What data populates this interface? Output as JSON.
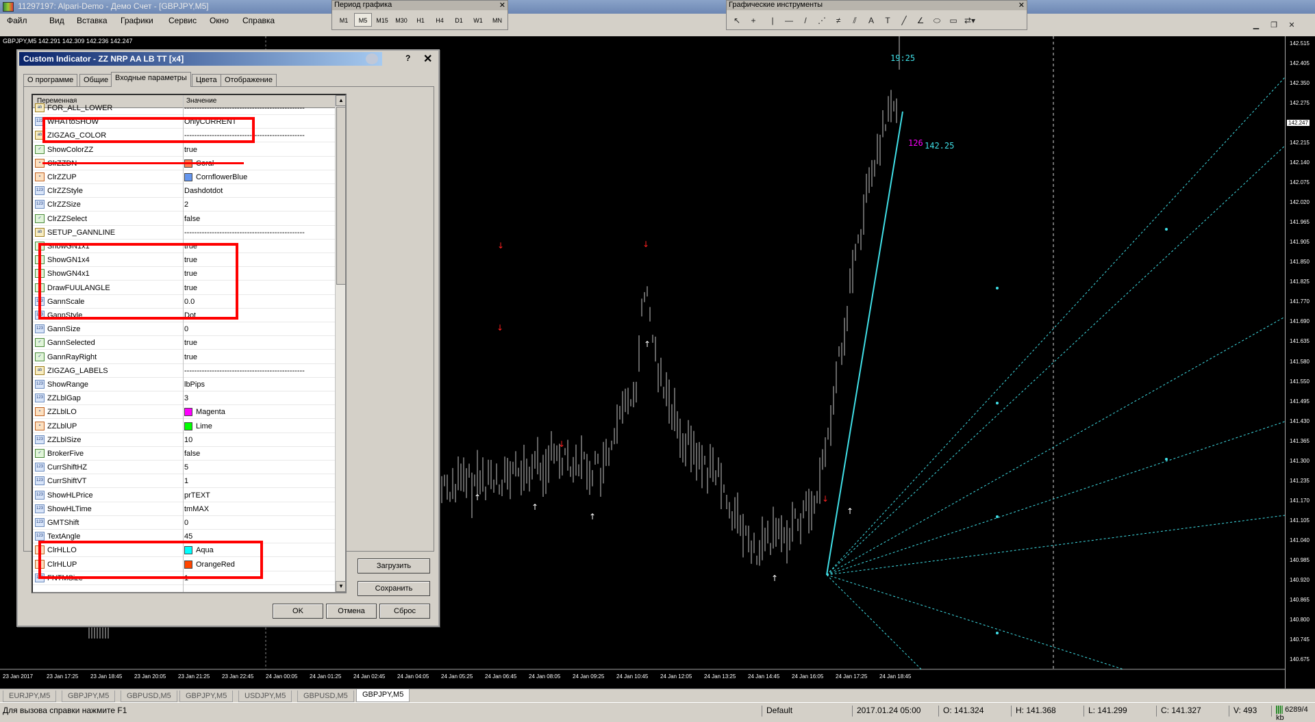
{
  "window": {
    "title": "11297197: Alpari-Demo - Демо Счет - [GBPJPY,M5]"
  },
  "menu": [
    "Файл",
    "Вид",
    "Вставка",
    "Графики",
    "Сервис",
    "Окно",
    "Справка"
  ],
  "period_toolbar": {
    "title": "Период графика",
    "periods": [
      "M1",
      "M5",
      "M15",
      "M30",
      "H1",
      "H4",
      "D1",
      "W1",
      "MN"
    ],
    "selected": "M5"
  },
  "tools_toolbar": {
    "title": "Графические инструменты",
    "tools": [
      "cursor-icon",
      "crosshair-icon",
      "vertical-line-icon",
      "horizontal-line-icon",
      "trendline-icon",
      "fibo-fan-icon",
      "gann-line-icon",
      "fibo-retracement-icon",
      "text-icon",
      "text-label-icon",
      "channel-icon",
      "angle-icon",
      "ellipse-icon",
      "rectangle-icon",
      "arrows-icon"
    ],
    "tool_glyphs": [
      "↖",
      "+",
      "|",
      "—",
      "/",
      "⋰",
      "≠",
      "⫽",
      "A",
      "T",
      "╱",
      "∠",
      "⬭",
      "▭",
      "⇄▾"
    ]
  },
  "chart": {
    "info": "GBPJPY,M5  142.291 142.309 142.236 142.247",
    "price_labels": [
      "142.515",
      "142.405",
      "142.350",
      "142.275",
      "142.247",
      "142.215",
      "142.140",
      "142.075",
      "142.020",
      "141.965",
      "141.905",
      "141.850",
      "141.825",
      "141.770",
      "141.690",
      "141.635",
      "141.580",
      "141.550",
      "141.495",
      "141.430",
      "141.365",
      "141.300",
      "141.235",
      "141.170",
      "141.105",
      "141.040",
      "140.985",
      "140.920",
      "140.865",
      "140.800",
      "140.745",
      "140.675"
    ],
    "current_price": "142.247",
    "time_labels": [
      "23 Jan 2017",
      "23 Jan 17:25",
      "23 Jan 18:45",
      "23 Jan 20:05",
      "23 Jan 21:25",
      "23 Jan 22:45",
      "24 Jan 00:05",
      "24 Jan 01:25",
      "24 Jan 02:45",
      "24 Jan 04:05",
      "24 Jan 05:25",
      "24 Jan 06:45",
      "24 Jan 08:05",
      "24 Jan 09:25",
      "24 Jan 10:45",
      "24 Jan 12:05",
      "24 Jan 13:25",
      "24 Jan 14:45",
      "24 Jan 16:05",
      "24 Jan 17:25",
      "24 Jan 18:45"
    ],
    "annotation_time": "19:25",
    "annotation_pips": "126",
    "annotation_price": "142.25",
    "colors": {
      "zz_line": "#40e0e8",
      "gann": "#40e0e8",
      "label_time": "#40e0e8",
      "label_pips": "#ff00ff",
      "arrow_dn": "#ff2020",
      "arrow_up": "#ffffff"
    }
  },
  "dialog": {
    "title": "Custom Indicator - ZZ NRP AA LB TT [x4]",
    "help": "?",
    "close": "✕",
    "tabs": [
      "О программе",
      "Общие",
      "Входные параметры",
      "Цвета",
      "Отображение"
    ],
    "selected_tab": "Входные параметры",
    "columns": {
      "var": "Переменная",
      "val": "Значение"
    },
    "rows": [
      {
        "name": "FOR_ALL_LOWER",
        "value": "------------------------------------------------",
        "type": "str"
      },
      {
        "name": "WHATtoSHOW",
        "value": "OnlyCURRENT",
        "type": "int"
      },
      {
        "name": "ZIGZAG_COLOR",
        "value": "------------------------------------------------",
        "type": "str"
      },
      {
        "name": "ShowColorZZ",
        "value": "true",
        "type": "bool"
      },
      {
        "name": "ClrZZDN",
        "value": "Coral",
        "type": "col",
        "color": "#ff7f50"
      },
      {
        "name": "ClrZZUP",
        "value": "CornflowerBlue",
        "type": "col",
        "color": "#6495ed"
      },
      {
        "name": "ClrZZStyle",
        "value": "Dashdotdot",
        "type": "int"
      },
      {
        "name": "ClrZZSize",
        "value": "2",
        "type": "int"
      },
      {
        "name": "ClrZZSelect",
        "value": "false",
        "type": "bool"
      },
      {
        "name": "SETUP_GANNLINE",
        "value": "------------------------------------------------",
        "type": "str"
      },
      {
        "name": "ShowGN1x1",
        "value": "true",
        "type": "bool"
      },
      {
        "name": "ShowGN1x4",
        "value": "true",
        "type": "bool"
      },
      {
        "name": "ShowGN4x1",
        "value": "true",
        "type": "bool"
      },
      {
        "name": "DrawFUULANGLE",
        "value": "true",
        "type": "bool"
      },
      {
        "name": "GannScale",
        "value": "0.0",
        "type": "int"
      },
      {
        "name": "GannStyle",
        "value": "Dot",
        "type": "int"
      },
      {
        "name": "GannSize",
        "value": "0",
        "type": "int"
      },
      {
        "name": "GannSelected",
        "value": "true",
        "type": "bool"
      },
      {
        "name": "GannRayRight",
        "value": "true",
        "type": "bool"
      },
      {
        "name": "ZIGZAG_LABELS",
        "value": "------------------------------------------------",
        "type": "str"
      },
      {
        "name": "ShowRange",
        "value": "lbPips",
        "type": "int"
      },
      {
        "name": "ZZLblGap",
        "value": "3",
        "type": "int"
      },
      {
        "name": "ZZLblLO",
        "value": "Magenta",
        "type": "col",
        "color": "#ff00ff"
      },
      {
        "name": "ZZLblUP",
        "value": "Lime",
        "type": "col",
        "color": "#00ff00"
      },
      {
        "name": "ZZLblSize",
        "value": "10",
        "type": "int"
      },
      {
        "name": "BrokerFive",
        "value": "false",
        "type": "bool"
      },
      {
        "name": "CurrShiftHZ",
        "value": "5",
        "type": "int"
      },
      {
        "name": "CurrShiftVT",
        "value": "1",
        "type": "int"
      },
      {
        "name": "ShowHLPrice",
        "value": "prTEXT",
        "type": "int"
      },
      {
        "name": "ShowHLTime",
        "value": "tmMAX",
        "type": "int"
      },
      {
        "name": "GMTShift",
        "value": "0",
        "type": "int"
      },
      {
        "name": "TextAngle",
        "value": "45",
        "type": "int"
      },
      {
        "name": "ClrHLLO",
        "value": "Aqua",
        "type": "col",
        "color": "#00ffff"
      },
      {
        "name": "ClrHLUP",
        "value": "OrangeRed",
        "type": "col",
        "color": "#ff4500"
      },
      {
        "name": "FNTMSize",
        "value": "1",
        "type": "int"
      }
    ],
    "buttons": {
      "load": "Загрузить",
      "save": "Сохранить",
      "ok": "OK",
      "cancel": "Отмена",
      "reset": "Сброс"
    }
  },
  "chart_tabs": [
    "EURJPY,M5",
    "GBPJPY,M5",
    "GBPUSD,M5",
    "GBPJPY,M5",
    "USDJPY,M5",
    "GBPUSD,M5",
    "GBPJPY,M5"
  ],
  "selected_chart_tab": 6,
  "status": {
    "help": "Для вызова справки нажмите F1",
    "profile": "Default",
    "datetime": "2017.01.24 05:00",
    "open": "O: 141.324",
    "high": "H: 141.368",
    "low": "L: 141.299",
    "close": "C: 141.327",
    "volume": "V: 493",
    "traffic": "6289/4 kb"
  }
}
